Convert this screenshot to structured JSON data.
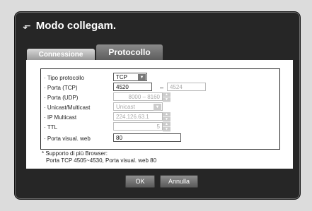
{
  "dialog": {
    "title": "Modo collegam.",
    "title_icon": "network-port-icon"
  },
  "tabs": [
    {
      "label": "Connessione",
      "active": false
    },
    {
      "label": "Protocollo",
      "active": true
    }
  ],
  "form": {
    "protocol_type": {
      "label": "· Tipo protocollo",
      "value": "TCP"
    },
    "port_tcp": {
      "label": "· Porta (TCP)",
      "value": "4520",
      "separator": "–",
      "end_value": "4524"
    },
    "port_udp": {
      "label": "· Porta (UDP)",
      "value": "8000 – 8160"
    },
    "unicast_multicast": {
      "label": "· Unicast/Multicast",
      "value": "Unicast"
    },
    "ip_multicast": {
      "label": "· IP Multicast",
      "value": "224.126.63.1"
    },
    "ttl": {
      "label": "· TTL",
      "value": "5"
    },
    "web_port": {
      "label": "· Porta visual. web",
      "value": "80"
    }
  },
  "note": {
    "line1": "* Supporto di più Browser:",
    "line2": "Porta TCP 4505~4530, Porta visual. web 80"
  },
  "buttons": {
    "ok": "OK",
    "cancel": "Annulla"
  },
  "colors": {
    "dialog_bg": "#262626",
    "panel_bg": "#ffffff",
    "tab_active": "#6e6e6e",
    "tab_inactive": "#bdbdbd"
  }
}
